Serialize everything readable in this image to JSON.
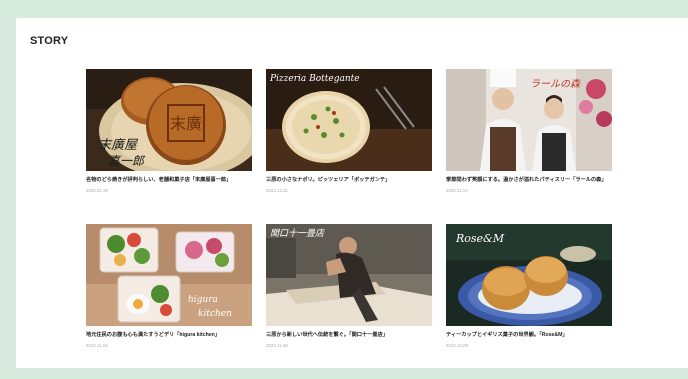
{
  "section": {
    "heading": "STORY"
  },
  "cards": [
    {
      "title": "名物のどら焼きが評判らしい、老舗和菓子店「末廣屋喜一郎」",
      "date": "2022.02.20",
      "image_alt": "dorayaki"
    },
    {
      "title": "三原の小さなナポリ。ピッツェリア「ボッテガンテ」",
      "date": "2022.12.21",
      "image_alt": "pizza",
      "overlay": "Pizzeria Bottegante"
    },
    {
      "title": "季節問わず笑顔にする。温かさが溢れたパティスリー「ラールの森」",
      "date": "2022.11.10",
      "image_alt": "patissiers",
      "overlay": "ラールの森"
    },
    {
      "title": "地元住民のお腹も心も満たすうどデリ「higura kitchen」",
      "date": "2022.11.04",
      "image_alt": "deli boxes",
      "overlay": "higura kitchen"
    },
    {
      "title": "三原から新しい世代へ伝統を繋ぐ。「関口十一畳店」",
      "date": "2022.11.08",
      "image_alt": "tatami craftsman",
      "overlay": "関口十一畳店"
    },
    {
      "title": "ティーカップとイギリス菓子の世界観。「Rose&M」",
      "date": "2022.10.08",
      "image_alt": "scones",
      "overlay": "Rose&M"
    }
  ]
}
